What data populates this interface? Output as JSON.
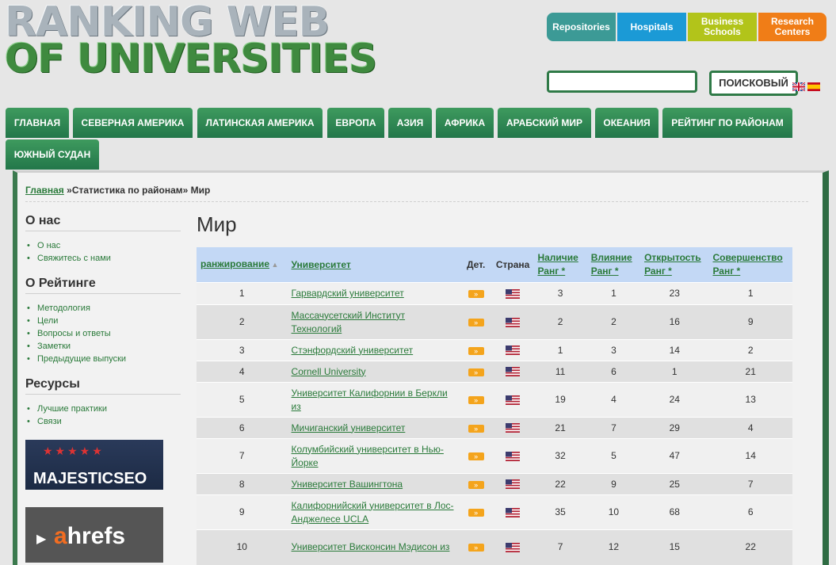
{
  "logo": {
    "line1": "RANKING WEB",
    "line2": "OF UNIVERSITIES"
  },
  "top_buttons": [
    {
      "label": "Repositories"
    },
    {
      "label": "Hospitals"
    },
    {
      "label": "Business Schools"
    },
    {
      "label": "Research Centers"
    }
  ],
  "search": {
    "value": "",
    "button_label": "ПОИСКОВЫЙ"
  },
  "nav": [
    "ГЛАВНАЯ",
    "СЕВЕРНАЯ АМЕРИКА",
    "ЛАТИНСКАЯ АМЕРИКА",
    "ЕВРОПА",
    "АЗИЯ",
    "АФРИКА",
    "АРАБСКИЙ МИР",
    "ОКЕАНИЯ",
    "РЕЙТИНГ ПО РАЙОНАМ",
    "ЮЖНЫЙ СУДАН"
  ],
  "breadcrumb": {
    "home": "Главная",
    "rest": " »Статистика по районам» Мир"
  },
  "sidebar": {
    "about": {
      "title": "О нас",
      "items": [
        "О нас",
        "Свяжитесь с нами"
      ]
    },
    "ranking": {
      "title": "О Рейтинге",
      "items": [
        "Методология",
        "Цели",
        "Вопросы и ответы",
        "Заметки",
        "Предыдущие выпуски"
      ]
    },
    "resources": {
      "title": "Ресурсы",
      "items": [
        "Лучшие практики",
        "Связи"
      ]
    },
    "ads": {
      "majestic": "MAJESTICSEO",
      "ahrefs_a": "a",
      "ahrefs_rest": "hrefs"
    }
  },
  "main": {
    "title": "Мир",
    "columns": {
      "rank": "ранжирование",
      "university": "Университет",
      "details": "Дет.",
      "country": "Страна",
      "presence": "Наличие Ранг *",
      "impact": "Влияние Ранг *",
      "openness": "Открытость Ранг *",
      "excellence": "Совершенство Ранг *"
    },
    "detail_glyph": "»",
    "rows": [
      {
        "rank": "1",
        "name": "Гарвардский университет",
        "presence": "3",
        "impact": "1",
        "openness": "23",
        "excellence": "1"
      },
      {
        "rank": "2",
        "name": "Массачусетский Институт Технологий",
        "presence": "2",
        "impact": "2",
        "openness": "16",
        "excellence": "9"
      },
      {
        "rank": "3",
        "name": "Стэнфордский университет",
        "presence": "1",
        "impact": "3",
        "openness": "14",
        "excellence": "2"
      },
      {
        "rank": "4",
        "name": "Cornell University",
        "presence": "11",
        "impact": "6",
        "openness": "1",
        "excellence": "21"
      },
      {
        "rank": "5",
        "name": "Университет Калифорнии в Беркли из",
        "presence": "19",
        "impact": "4",
        "openness": "24",
        "excellence": "13"
      },
      {
        "rank": "6",
        "name": "Мичиганский университет",
        "presence": "21",
        "impact": "7",
        "openness": "29",
        "excellence": "4"
      },
      {
        "rank": "7",
        "name": "Колумбийский университет в Нью-Йорке",
        "presence": "32",
        "impact": "5",
        "openness": "47",
        "excellence": "14"
      },
      {
        "rank": "8",
        "name": "Университет Вашингтона",
        "presence": "22",
        "impact": "9",
        "openness": "25",
        "excellence": "7"
      },
      {
        "rank": "9",
        "name": "Калифорнийский университет в Лос-Анджелесе UCLA",
        "presence": "35",
        "impact": "10",
        "openness": "68",
        "excellence": "6"
      },
      {
        "rank": "10",
        "name": "Университет Висконсин Мэдисон из",
        "presence": "7",
        "impact": "12",
        "openness": "15",
        "excellence": "22"
      }
    ]
  },
  "colors": {
    "nav_green": "#2f8a55",
    "link_green": "#2a7a3a",
    "table_header": "#c3d8f5"
  }
}
